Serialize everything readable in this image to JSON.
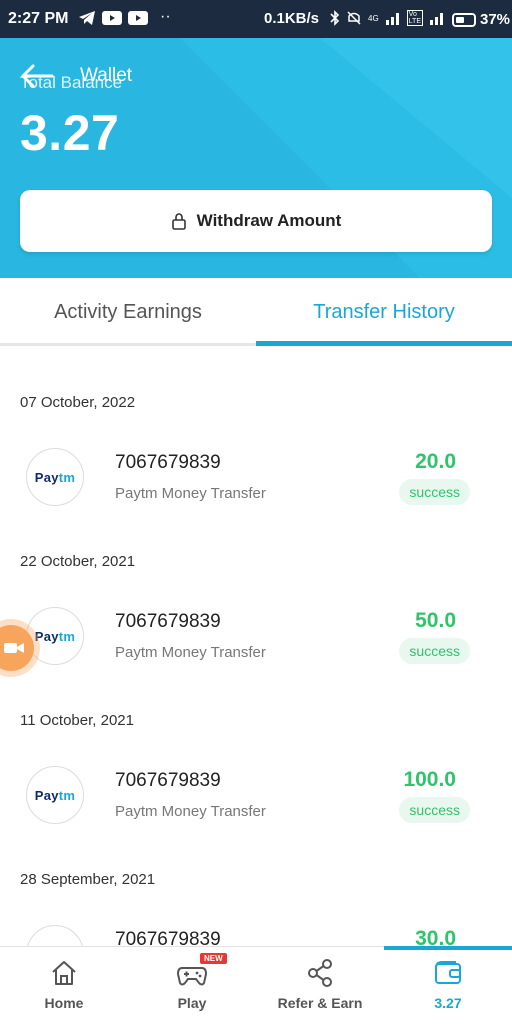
{
  "status_bar": {
    "time": "2:27 PM",
    "dots": "··",
    "speed": "0.1KB/s",
    "battery": "37%",
    "network_label": "4G",
    "volte_label": "Vo LTE"
  },
  "header": {
    "title": "Wallet",
    "balance_label": "Total Balance",
    "balance_value": "3.27",
    "withdraw_label": "Withdraw Amount",
    "color": "#29b6e0"
  },
  "tabs": [
    {
      "label": "Activity Earnings",
      "active": false
    },
    {
      "label": "Transfer History",
      "active": true
    }
  ],
  "transactions": [
    {
      "date": "07 October, 2022",
      "phone": "7067679839",
      "type": "Paytm Money Transfer",
      "amount": "20.0",
      "status": "success",
      "logo_pay": "Pay",
      "logo_tm": "tm"
    },
    {
      "date": "22 October, 2021",
      "phone": "7067679839",
      "type": "Paytm Money Transfer",
      "amount": "50.0",
      "status": "success",
      "logo_pay": "Pay",
      "logo_tm": "tm"
    },
    {
      "date": "11 October, 2021",
      "phone": "7067679839",
      "type": "Paytm Money Transfer",
      "amount": "100.0",
      "status": "success",
      "logo_pay": "Pay",
      "logo_tm": "tm"
    },
    {
      "date": "28 September, 2021",
      "phone": "7067679839",
      "type": "",
      "amount": "30.0",
      "status": "",
      "logo_pay": "",
      "logo_tm": ""
    }
  ],
  "bottom_nav": [
    {
      "label": "Home",
      "icon": "home-icon",
      "active": false
    },
    {
      "label": "Play",
      "icon": "gamepad-icon",
      "active": false,
      "badge": "NEW"
    },
    {
      "label": "Refer & Earn",
      "icon": "share-icon",
      "active": false
    },
    {
      "label": "3.27",
      "icon": "wallet-icon",
      "active": true
    }
  ],
  "colors": {
    "accent": "#1aa7d8",
    "success": "#2ec46a",
    "success_bg": "#e8f8ee",
    "status_bar": "#1d2b40"
  }
}
